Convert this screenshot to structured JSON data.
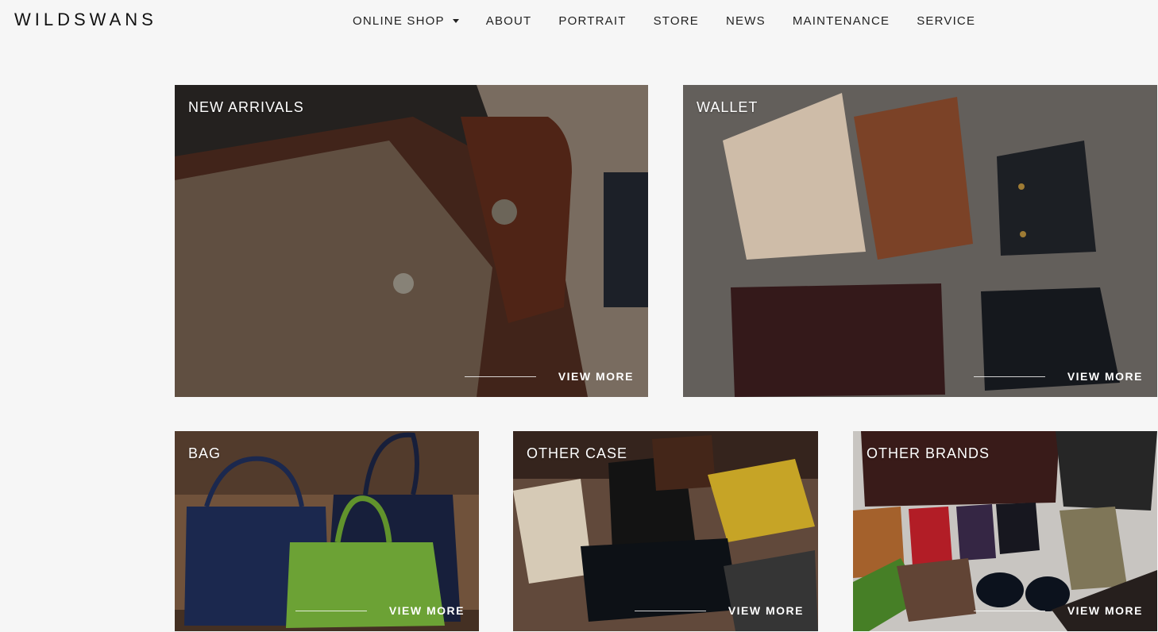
{
  "brand": {
    "logo_text": "WILDSWANS"
  },
  "nav": {
    "items": [
      {
        "label": "ONLINE SHOP",
        "has_dropdown": true
      },
      {
        "label": "ABOUT"
      },
      {
        "label": "PORTRAIT"
      },
      {
        "label": "STORE"
      },
      {
        "label": "NEWS"
      },
      {
        "label": "MAINTENANCE"
      },
      {
        "label": "SERVICE"
      }
    ]
  },
  "categories": [
    {
      "label": "NEW ARRIVALS",
      "cta": "VIEW MORE"
    },
    {
      "label": "WALLET",
      "cta": "VIEW MORE"
    },
    {
      "label": "BAG",
      "cta": "VIEW MORE"
    },
    {
      "label": "OTHER CASE",
      "cta": "VIEW MORE"
    },
    {
      "label": "OTHER BRANDS",
      "cta": "VIEW MORE"
    }
  ],
  "colors": {
    "background": "#f6f6f6",
    "text": "#222222",
    "overlay_text": "#ffffff"
  }
}
